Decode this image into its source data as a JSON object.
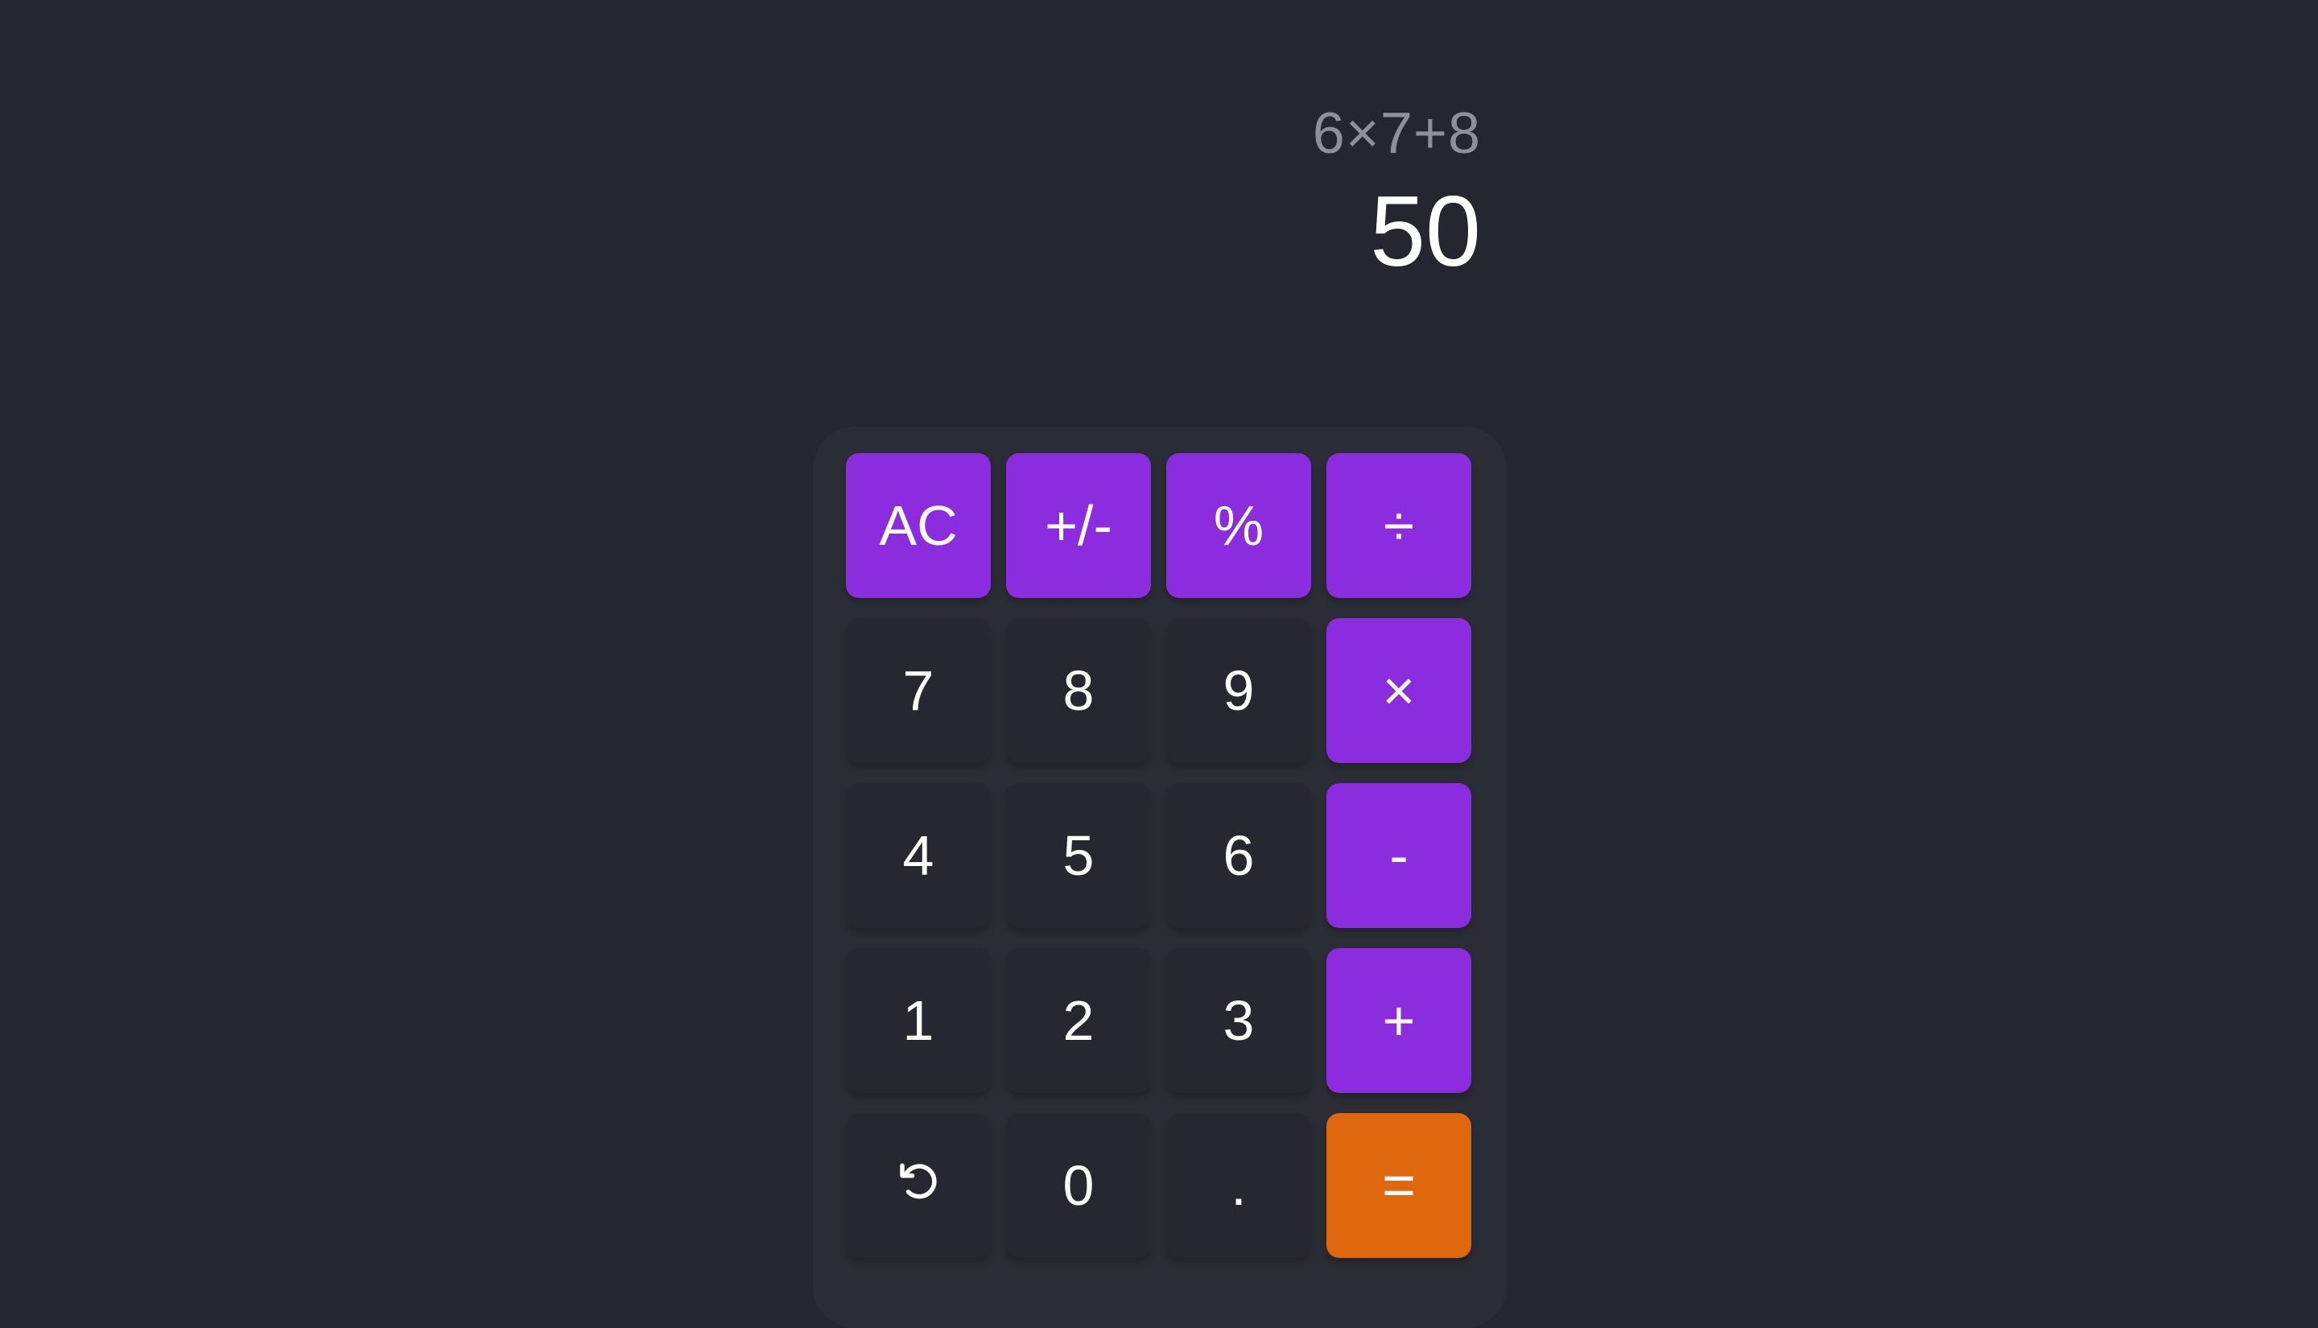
{
  "display": {
    "expression": "6×7+8",
    "result": "50"
  },
  "keypad": {
    "rows": [
      [
        {
          "label": "AC",
          "name": "clear-button",
          "kind": "op"
        },
        {
          "label": "+/-",
          "name": "negate-button",
          "kind": "op"
        },
        {
          "label": "%",
          "name": "percent-button",
          "kind": "op"
        },
        {
          "label": "÷",
          "name": "divide-button",
          "kind": "op"
        }
      ],
      [
        {
          "label": "7",
          "name": "digit-7-button",
          "kind": "num"
        },
        {
          "label": "8",
          "name": "digit-8-button",
          "kind": "num"
        },
        {
          "label": "9",
          "name": "digit-9-button",
          "kind": "num"
        },
        {
          "label": "×",
          "name": "multiply-button",
          "kind": "op"
        }
      ],
      [
        {
          "label": "4",
          "name": "digit-4-button",
          "kind": "num"
        },
        {
          "label": "5",
          "name": "digit-5-button",
          "kind": "num"
        },
        {
          "label": "6",
          "name": "digit-6-button",
          "kind": "num"
        },
        {
          "label": "-",
          "name": "subtract-button",
          "kind": "op"
        }
      ],
      [
        {
          "label": "1",
          "name": "digit-1-button",
          "kind": "num"
        },
        {
          "label": "2",
          "name": "digit-2-button",
          "kind": "num"
        },
        {
          "label": "3",
          "name": "digit-3-button",
          "kind": "num"
        },
        {
          "label": "+",
          "name": "add-button",
          "kind": "op"
        }
      ],
      [
        {
          "icon": "undo-icon",
          "name": "undo-button",
          "kind": "num"
        },
        {
          "label": "0",
          "name": "digit-0-button",
          "kind": "num"
        },
        {
          "label": ".",
          "name": "decimal-button",
          "kind": "num"
        },
        {
          "label": "=",
          "name": "equals-button",
          "kind": "eq"
        }
      ]
    ]
  },
  "colors": {
    "background": "#252630",
    "keypad": "#2b2d36",
    "number_key": "#262730",
    "operator_key": "#8c2cdf",
    "equals_key": "#e0670e",
    "expression_text": "#8e8f98",
    "result_text": "#ffffff"
  }
}
